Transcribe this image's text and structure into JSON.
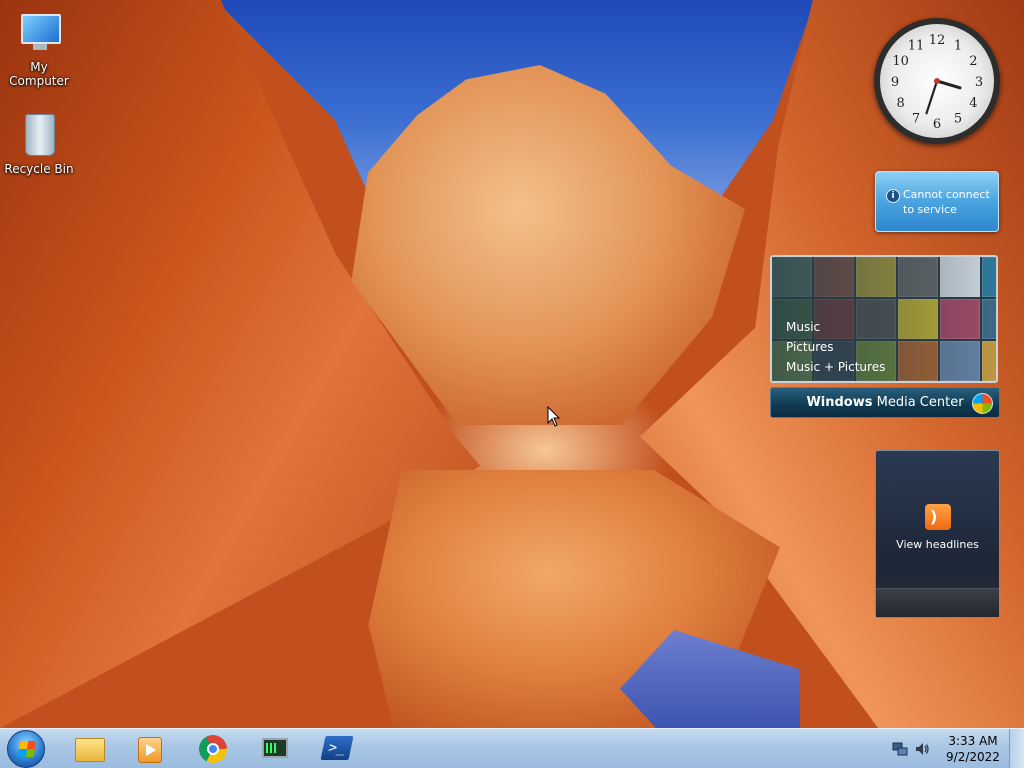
{
  "desktop": {
    "icons": [
      {
        "label": "My Computer",
        "icon": "computer-icon"
      },
      {
        "label": "Recycle Bin",
        "icon": "recycle-bin-icon"
      }
    ]
  },
  "gadgets": {
    "clock": {
      "numbers": [
        "12",
        "1",
        "2",
        "3",
        "4",
        "5",
        "6",
        "7",
        "8",
        "9",
        "10",
        "11"
      ],
      "hour": 3,
      "minute": 33
    },
    "weather": {
      "message_line1": "Cannot connect",
      "message_line2": "to service",
      "icon": "info-icon"
    },
    "media_center": {
      "menu": [
        "Music",
        "Pictures",
        "Music + Pictures"
      ],
      "brand_bold": "Windows",
      "brand_rest": "Media Center",
      "tile_colors": [
        "#6a8a7a",
        "#9b5a45",
        "#c8b23a",
        "#6e6e6e",
        "#dfe6ee",
        "#2f7fa1",
        "#4a7a4a",
        "#8e3d3d",
        "#5a5a5a",
        "#d8c430",
        "#b04a6a",
        "#3e6e8e",
        "#8ab04a",
        "#3a4a5a",
        "#7a9a3a",
        "#c06a30",
        "#6a8ab0",
        "#d0a040"
      ]
    },
    "feeds": {
      "label": "View headlines",
      "icon": "rss-icon"
    }
  },
  "taskbar": {
    "start_icon": "windows-start-icon",
    "pinned": [
      {
        "name": "Windows Explorer",
        "icon": "folder-icon"
      },
      {
        "name": "Windows Media Player",
        "icon": "media-player-icon"
      },
      {
        "name": "Google Chrome",
        "icon": "chrome-icon"
      },
      {
        "name": "Task Manager",
        "icon": "task-manager-icon"
      },
      {
        "name": "PowerShell",
        "icon": "powershell-icon"
      }
    ],
    "tray": {
      "network_icon": "network-icon",
      "volume_icon": "volume-icon",
      "time": "3:33 AM",
      "date": "9/2/2022"
    }
  },
  "colors": {
    "taskbar_top": "#c6dcf0",
    "taskbar_bottom": "#9bbcdf",
    "weather_blue": "#4aa4e0"
  }
}
